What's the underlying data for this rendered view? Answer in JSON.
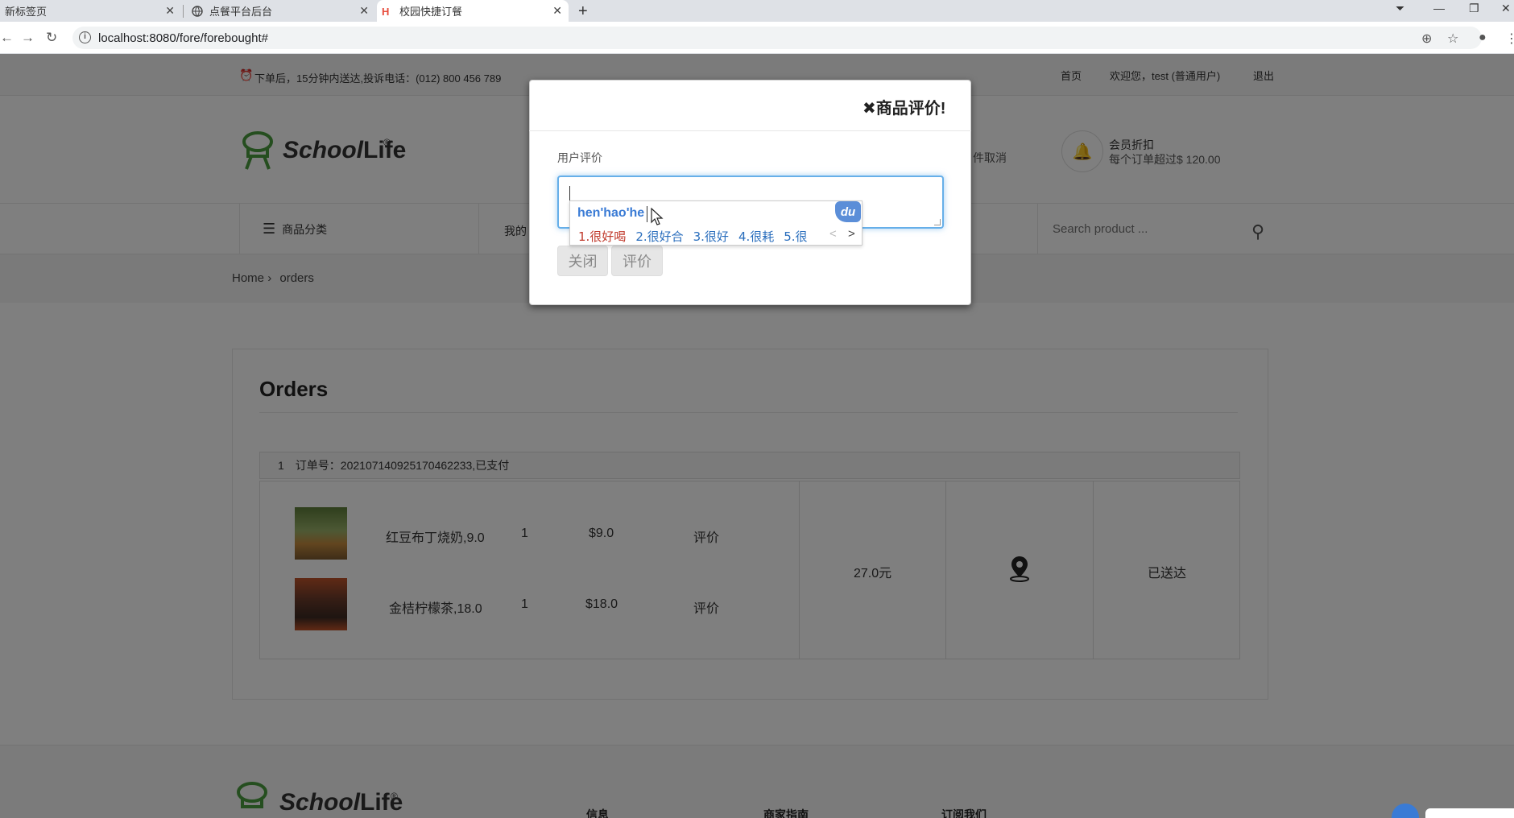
{
  "browser": {
    "tabs": [
      {
        "label": "新标签页"
      },
      {
        "label": "点餐平台后台"
      },
      {
        "label": "校园快捷订餐"
      }
    ],
    "url": "localhost:8080/fore/forebought#"
  },
  "topbar": {
    "notice": "下单后，15分钟内送达,投诉电话：(012) 800 456 789",
    "links": [
      "首页",
      "欢迎您，test (普通用户)",
      "退出"
    ]
  },
  "header": {
    "logo_text_a": "School",
    "logo_text_b": "Life",
    "trademark": "®",
    "promo_partial": "件取消",
    "member_title": "会员折扣",
    "member_desc": "每个订单超过$ 120.00"
  },
  "nav": {
    "category_label": "商品分类",
    "partial_item": "我的",
    "search_placeholder": "Search product ..."
  },
  "breadcrumb": {
    "home": "Home",
    "separator": "›",
    "current": "orders"
  },
  "orders": {
    "title": "Orders",
    "order": {
      "index": "1",
      "summary": "订单号：20210714092517046223​3,已支付",
      "items": [
        {
          "name": "红豆布丁烧奶,9.0",
          "qty": "1",
          "price": "$9.0",
          "action": "评价"
        },
        {
          "name": "金桔柠檬茶,18.0",
          "qty": "1",
          "price": "$18.0",
          "action": "评价"
        }
      ],
      "total": "27.0元",
      "status": "已送达"
    }
  },
  "footer": {
    "cols": [
      "信息",
      "商家指南",
      "订阅我们"
    ]
  },
  "modal": {
    "title": "✖商品评价!",
    "label": "用户评价",
    "close_button": "关闭",
    "submit_button": "评价"
  },
  "ime": {
    "pinyin": "hen'hao'he",
    "badge": "du",
    "candidates": [
      "1.很好喝",
      "2.很好合",
      "3.很好",
      "4.很耗",
      "5.很"
    ],
    "prev": "<",
    "next": ">"
  }
}
